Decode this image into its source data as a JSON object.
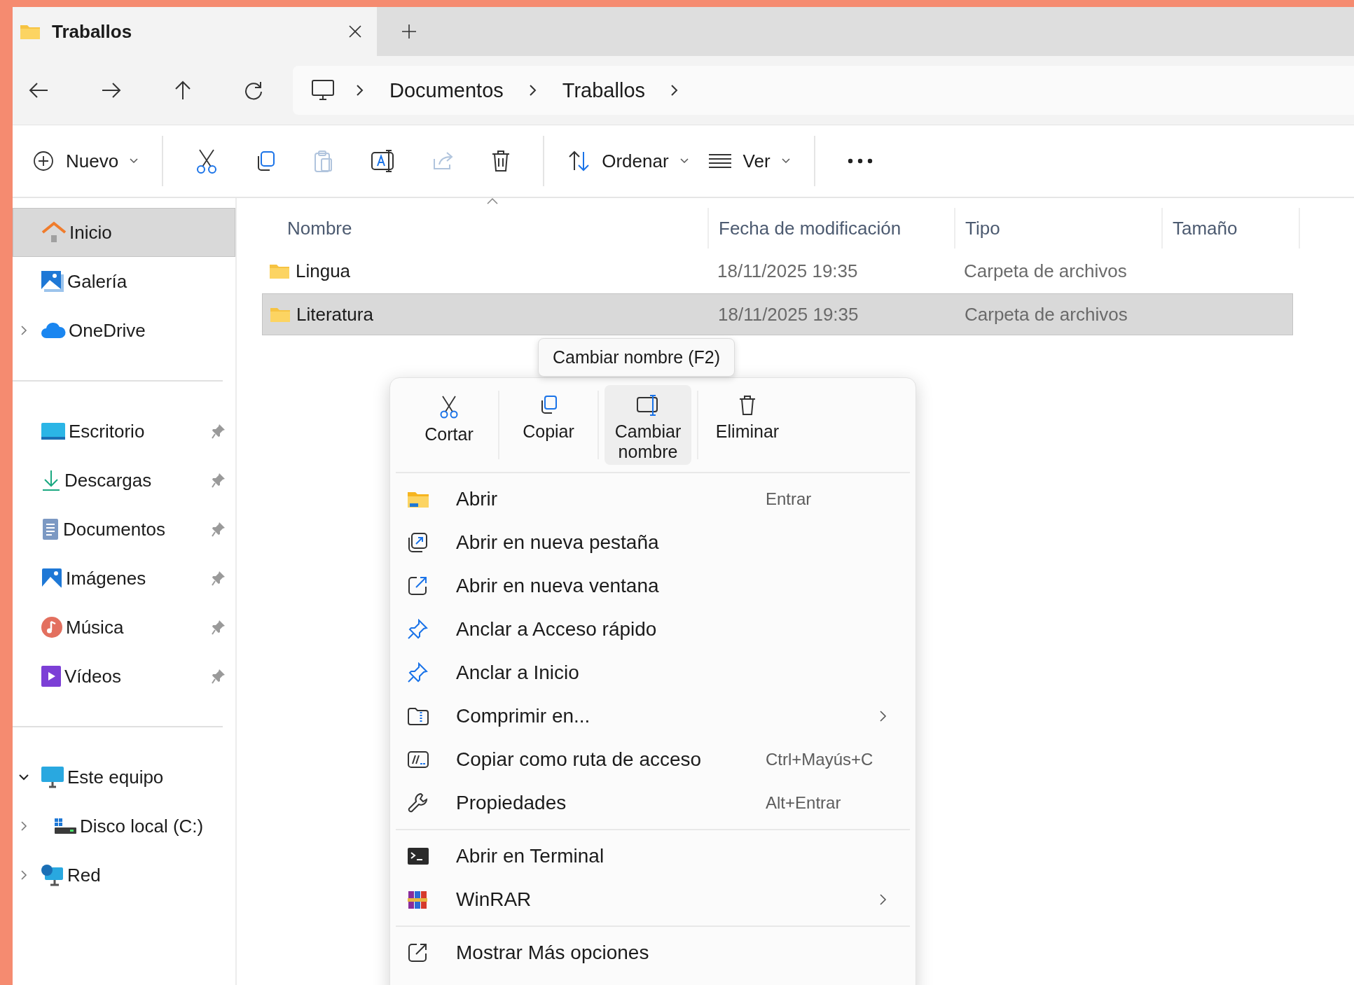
{
  "tabs": [
    {
      "title": "Traballos",
      "selected": true
    }
  ],
  "breadcrumb": [
    "Documentos",
    "Traballos"
  ],
  "toolbar": {
    "new": "Nuevo",
    "sort": "Ordenar",
    "view": "Ver"
  },
  "sidebar": {
    "groups": [
      [
        {
          "label": "Inicio",
          "selected": true
        },
        {
          "label": "Galería",
          "selected": false
        },
        {
          "label": "OneDrive",
          "selected": false,
          "expanded": false
        }
      ],
      [
        {
          "label": "Escritorio",
          "selected": false,
          "pinned": true
        },
        {
          "label": "Descargas",
          "selected": false,
          "pinned": true
        },
        {
          "label": "Documentos",
          "selected": false,
          "pinned": true
        },
        {
          "label": "Imágenes",
          "selected": false,
          "pinned": true
        },
        {
          "label": "Música",
          "selected": false,
          "pinned": true
        },
        {
          "label": "Vídeos",
          "selected": false,
          "pinned": true
        }
      ],
      [
        {
          "label": "Este equipo",
          "selected": false,
          "expanded": true,
          "children": [
            {
              "label": "Disco local (C:)",
              "selected": false,
              "expanded": false
            }
          ]
        },
        {
          "label": "Red",
          "selected": false,
          "expanded": false
        }
      ]
    ]
  },
  "columns": [
    "Nombre",
    "Fecha de modificación",
    "Tipo",
    "Tamaño"
  ],
  "rows": [
    {
      "name": "Lingua",
      "modified": "18/11/2025 19:35",
      "type": "Carpeta de archivos",
      "selected": false
    },
    {
      "name": "Literatura",
      "modified": "18/11/2025 19:35",
      "type": "Carpeta de archivos",
      "selected": true
    }
  ],
  "context_menu": {
    "tooltip": "Cambiar nombre (F2)",
    "quick_actions": [
      {
        "label": "Cortar",
        "selected": false
      },
      {
        "label": "Copiar",
        "selected": false
      },
      {
        "label": "Cambiar nombre",
        "selected": true
      },
      {
        "label": "Eliminar",
        "selected": false
      }
    ],
    "sections": [
      [
        {
          "label": "Abrir",
          "shortcut": "Entrar",
          "submenu": false
        },
        {
          "label": "Abrir en nueva pestaña",
          "submenu": false
        },
        {
          "label": "Abrir en nueva ventana",
          "submenu": false
        },
        {
          "label": "Anclar a Acceso rápido",
          "submenu": false
        },
        {
          "label": "Anclar a Inicio",
          "submenu": false
        },
        {
          "label": "Comprimir en...",
          "submenu": true
        },
        {
          "label": "Copiar como ruta de acceso",
          "shortcut": "Ctrl+Mayús+C",
          "submenu": false
        },
        {
          "label": "Propiedades",
          "shortcut": "Alt+Entrar",
          "submenu": false
        }
      ],
      [
        {
          "label": "Abrir en Terminal",
          "submenu": false
        },
        {
          "label": "WinRAR",
          "submenu": true
        }
      ],
      [
        {
          "label": "Mostrar Más opciones",
          "submenu": false
        }
      ]
    ]
  }
}
